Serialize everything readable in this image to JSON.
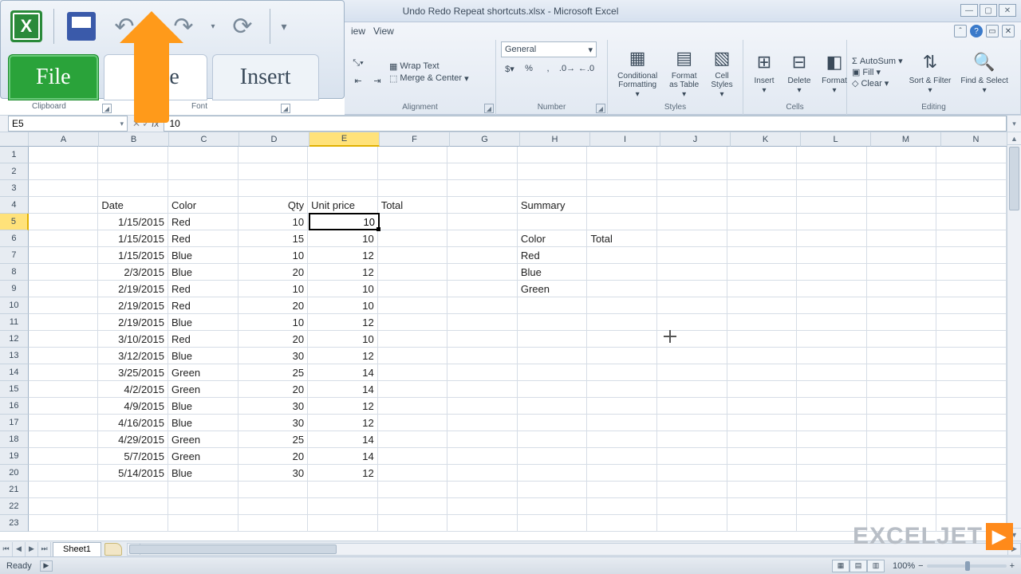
{
  "title": "Undo Redo Repeat shortcuts.xlsx - Microsoft Excel",
  "bigtabs": {
    "file": "File",
    "home": "me",
    "insert": "Insert"
  },
  "ribbon_tabs": {
    "review_tail": "iew",
    "view": "View"
  },
  "groups": {
    "clipboard": "Clipboard",
    "font": "Font",
    "alignment": "Alignment",
    "number": "Number",
    "styles": "Styles",
    "cells": "Cells",
    "editing": "Editing"
  },
  "alignment": {
    "wrap": "Wrap Text",
    "merge": "Merge & Center"
  },
  "number_format": "General",
  "styles": {
    "cond": "Conditional Formatting",
    "table": "Format as Table",
    "cell": "Cell Styles"
  },
  "cells": {
    "insert": "Insert",
    "delete": "Delete",
    "format": "Format"
  },
  "editing": {
    "autosum": "AutoSum",
    "fill": "Fill",
    "clear": "Clear",
    "sort": "Sort & Filter",
    "find": "Find & Select"
  },
  "namebox": "E5",
  "formula": "10",
  "columns": [
    "A",
    "B",
    "C",
    "D",
    "E",
    "F",
    "G",
    "H",
    "I",
    "J",
    "K",
    "L",
    "M",
    "N"
  ],
  "active_col": "E",
  "active_row": 5,
  "active_value": "10",
  "headers": {
    "date": "Date",
    "color": "Color",
    "qty": "Qty",
    "price": "Unit price",
    "total": "Total",
    "summary": "Summary"
  },
  "side": {
    "color": "Color",
    "total": "Total",
    "rows": [
      "Red",
      "Blue",
      "Green"
    ]
  },
  "chart_data": {
    "type": "table",
    "columns": [
      "Date",
      "Color",
      "Qty",
      "Unit price"
    ],
    "rows": [
      [
        "1/15/2015",
        "Red",
        10,
        10
      ],
      [
        "1/15/2015",
        "Red",
        15,
        10
      ],
      [
        "1/15/2015",
        "Blue",
        10,
        12
      ],
      [
        "2/3/2015",
        "Blue",
        20,
        12
      ],
      [
        "2/19/2015",
        "Red",
        10,
        10
      ],
      [
        "2/19/2015",
        "Red",
        20,
        10
      ],
      [
        "2/19/2015",
        "Blue",
        10,
        12
      ],
      [
        "3/10/2015",
        "Red",
        20,
        10
      ],
      [
        "3/12/2015",
        "Blue",
        30,
        12
      ],
      [
        "3/25/2015",
        "Green",
        25,
        14
      ],
      [
        "4/2/2015",
        "Green",
        20,
        14
      ],
      [
        "4/9/2015",
        "Blue",
        30,
        12
      ],
      [
        "4/16/2015",
        "Blue",
        30,
        12
      ],
      [
        "4/29/2015",
        "Green",
        25,
        14
      ],
      [
        "5/7/2015",
        "Green",
        20,
        14
      ],
      [
        "5/14/2015",
        "Blue",
        30,
        12
      ]
    ]
  },
  "sheet": "Sheet1",
  "status": "Ready",
  "zoom": "100%",
  "watermark": "EXCELJET"
}
